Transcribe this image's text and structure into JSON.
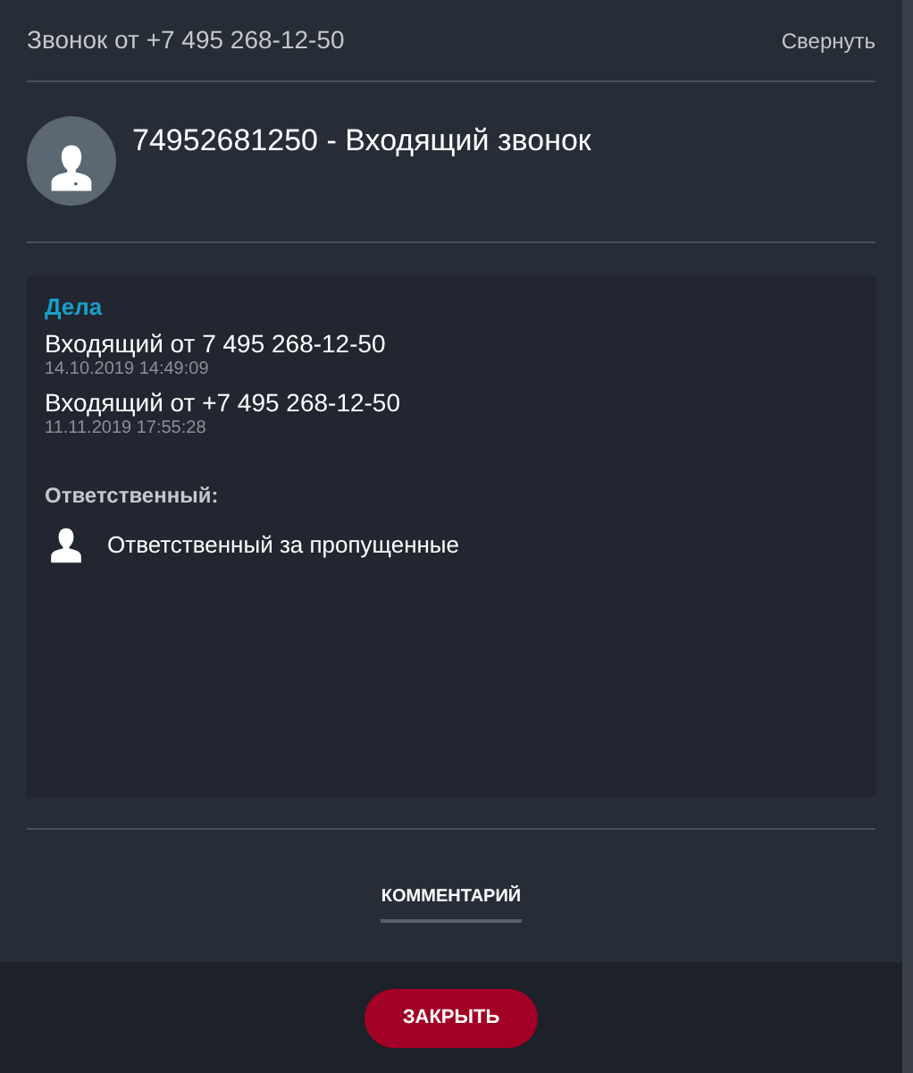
{
  "header": {
    "title": "Звонок от +7 495 268-12-50",
    "collapse_link": "Свернуть"
  },
  "contact": {
    "title": "74952681250 - Входящий звонок"
  },
  "deals": {
    "heading": "Дела",
    "items": [
      {
        "title": "Входящий от 7 495 268-12-50",
        "date": "14.10.2019 14:49:09"
      },
      {
        "title": "Входящий от +7 495 268-12-50",
        "date": "11.11.2019 17:55:28"
      }
    ]
  },
  "responsible": {
    "label": "Ответственный:",
    "name": "Ответственный за пропущенные"
  },
  "tabs": [
    {
      "label": "КОММЕНТАРИЙ",
      "selected": true
    }
  ],
  "footer": {
    "close_button": "ЗАКРЫТЬ"
  }
}
